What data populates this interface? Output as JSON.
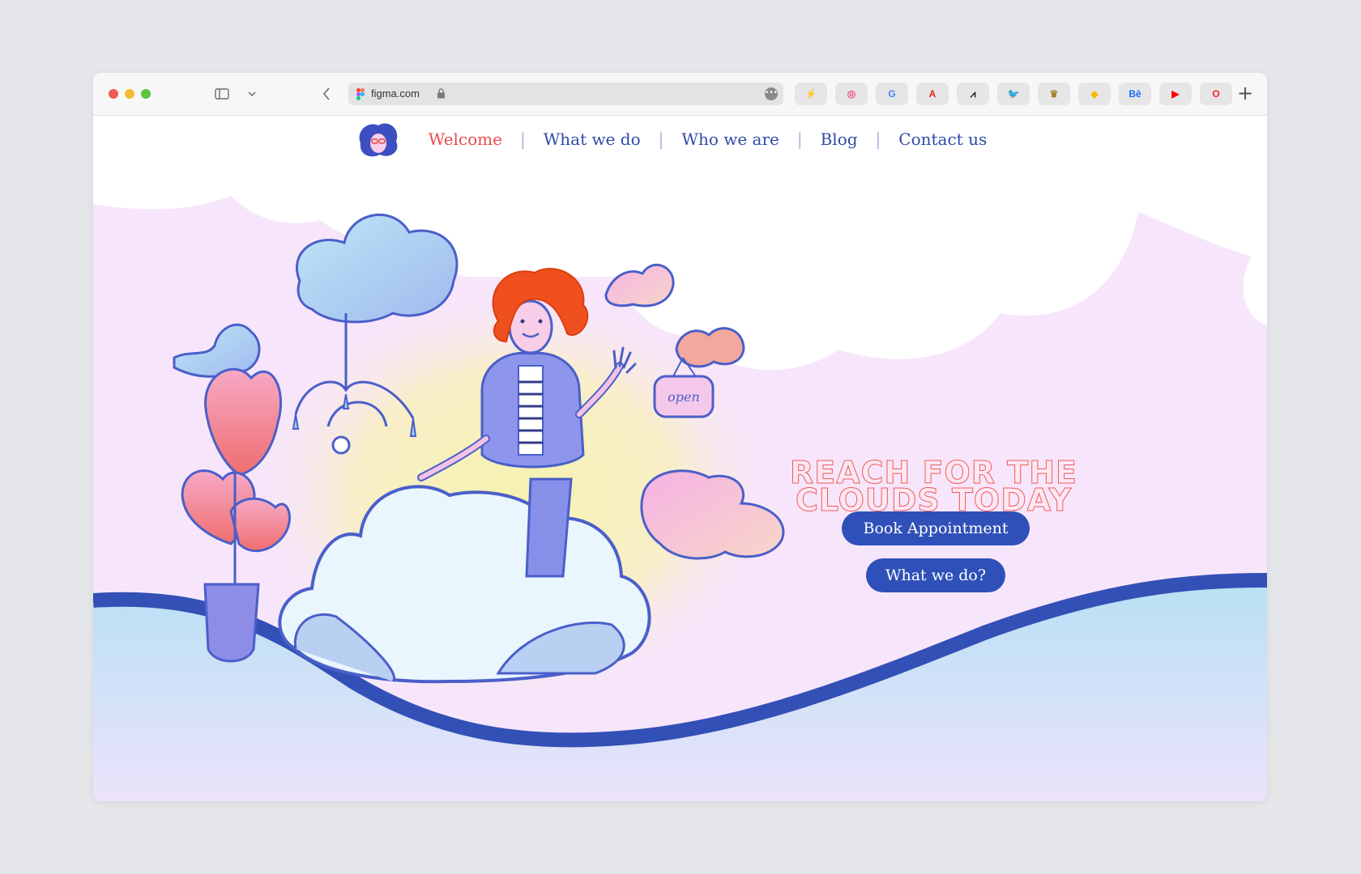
{
  "browser": {
    "url": "figma.com",
    "bookmarks": [
      {
        "name": "bookmark-lightning",
        "glyph": "⚡",
        "color": "#f2b600"
      },
      {
        "name": "bookmark-dribbble",
        "glyph": "◎",
        "color": "#ea4c89"
      },
      {
        "name": "bookmark-google",
        "glyph": "G",
        "color": "#4285f4"
      },
      {
        "name": "bookmark-adobe",
        "glyph": "A",
        "color": "#e1251b"
      },
      {
        "name": "bookmark-adidas",
        "glyph": "⩘",
        "color": "#111111"
      },
      {
        "name": "bookmark-twitter",
        "glyph": "🐦",
        "color": "#1da1f2"
      },
      {
        "name": "bookmark-rolex",
        "glyph": "♛",
        "color": "#a37e2c"
      },
      {
        "name": "bookmark-sketch",
        "glyph": "◆",
        "color": "#f7b500"
      },
      {
        "name": "bookmark-behance",
        "glyph": "Bē",
        "color": "#1769ff"
      },
      {
        "name": "bookmark-youtube",
        "glyph": "▶",
        "color": "#ff0000"
      },
      {
        "name": "bookmark-opera",
        "glyph": "O",
        "color": "#ff1b2d"
      }
    ]
  },
  "nav": {
    "items": [
      "Welcome",
      "What we do",
      "Who we are",
      "Blog",
      "Contact us"
    ]
  },
  "hero": {
    "title_line1": "REACH FOR THE",
    "title_line2": "CLOUDS TODAY",
    "primary_button": "Book Appointment",
    "secondary_button": "What we do?",
    "sign_text": "open"
  },
  "colors": {
    "accent_red": "#e84a4a",
    "brand_blue": "#2f50b8",
    "background_pink": "#f7e6fb"
  }
}
